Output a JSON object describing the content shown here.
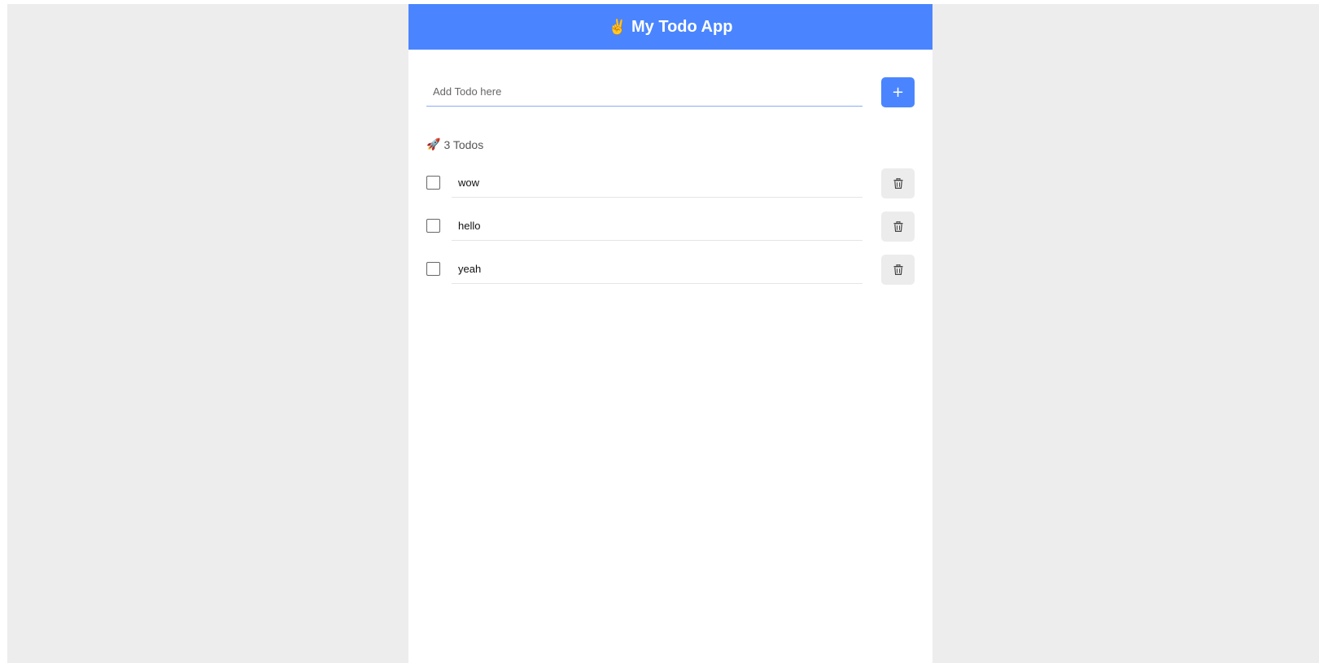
{
  "header": {
    "emoji": "✌️",
    "title": "My Todo App"
  },
  "add_form": {
    "placeholder": "Add Todo here",
    "value": "",
    "button_label": "+"
  },
  "count": {
    "emoji": "🚀",
    "label": "3 Todos"
  },
  "todos": [
    {
      "text": "wow",
      "done": false,
      "delete_icon": "trash-icon"
    },
    {
      "text": "hello",
      "done": false,
      "delete_icon": "trash-icon"
    },
    {
      "text": "yeah",
      "done": false,
      "delete_icon": "trash-icon"
    }
  ],
  "colors": {
    "accent": "#4a85ff",
    "page_background": "#ededed",
    "delete_button_background": "#ececec"
  }
}
